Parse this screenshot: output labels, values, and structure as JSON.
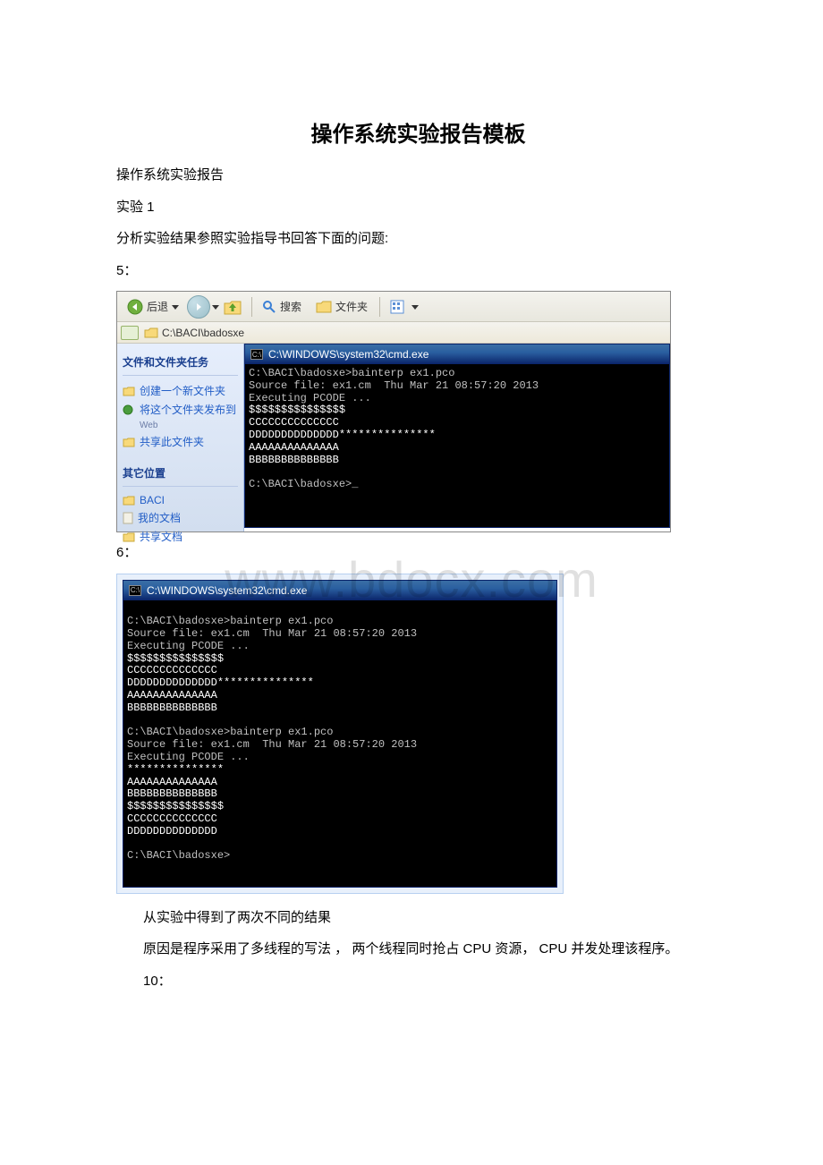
{
  "title": "操作系统实验报告模板",
  "p1": "操作系统实验报告",
  "p2": "实验 1",
  "p3": "分析实验结果参照实验指导书回答下面的问题:",
  "p4": "5：",
  "p5": "6：",
  "p6": "从实验中得到了两次不同的结果",
  "p7": "原因是程序采用了多线程的写法 ， 两个线程同时抢占 CPU 资源， CPU 并发处理该程序。",
  "p8": "10：",
  "watermark": "www.bdocx.com",
  "toolbar": {
    "back": "后退",
    "search": "搜索",
    "folders": "文件夹"
  },
  "address": "C:\\BACI\\badosxe",
  "sidebar": {
    "head1": "文件和文件夹任务",
    "items1": [
      "创建一个新文件夹",
      "将这个文件夹发布到",
      "Web",
      "共享此文件夹"
    ],
    "head2": "其它位置",
    "items2": [
      "BACI",
      "我的文档",
      "共享文档"
    ]
  },
  "cmd": {
    "title": "C:\\WINDOWS\\system32\\cmd.exe",
    "icon_label": "C:\\",
    "run1_prompt": "C:\\BACI\\badosxe>bainterp ex1.pco",
    "run1_src": "Source file: ex1.cm  Thu Mar 21 08:57:20 2013",
    "executing": "Executing PCODE ...",
    "line_dollar": "$$$$$$$$$$$$$$$",
    "line_c": "CCCCCCCCCCCCCC",
    "line_dstar": "DDDDDDDDDDDDDD***************",
    "line_a": "AAAAAAAAAAAAAA",
    "line_b": "BBBBBBBBBBBBBB",
    "end_prompt_cursor": "C:\\BACI\\badosxe>_",
    "end_prompt": "C:\\BACI\\badosxe>",
    "line_star": "***************",
    "line_d": "DDDDDDDDDDDDDD"
  }
}
